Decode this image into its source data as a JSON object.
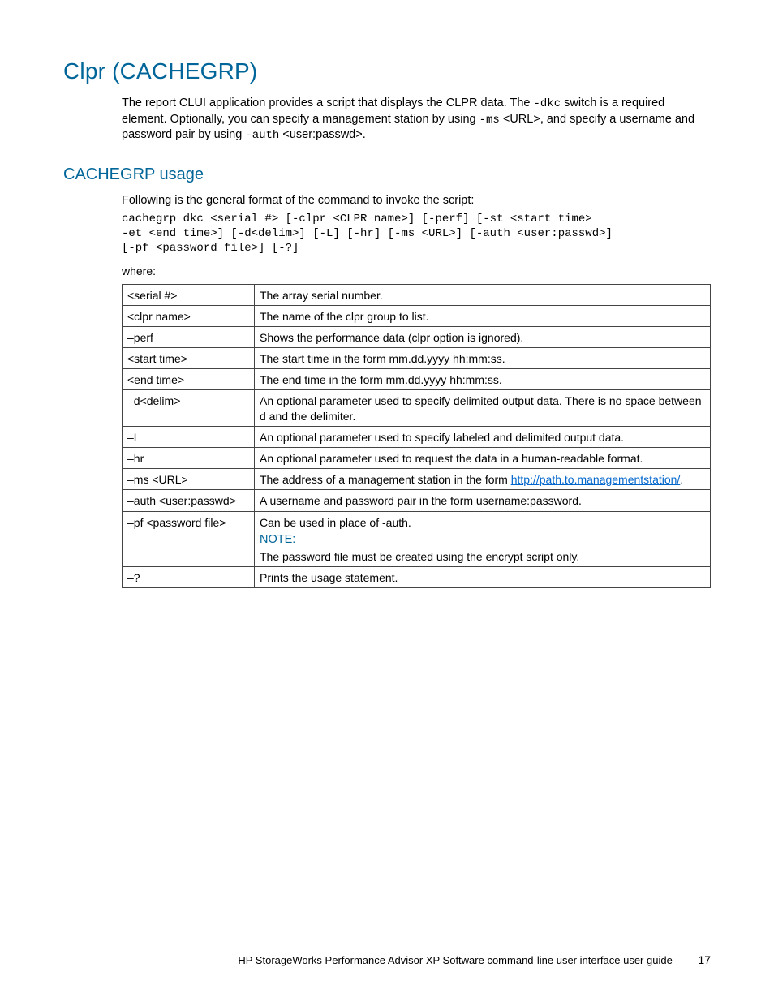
{
  "h1": "Clpr (CACHEGRP)",
  "intro": {
    "pre_dkc": "The report CLUI application provides a script that displays the CLPR data. The ",
    "dkc": "-dkc",
    "post_dkc": " switch is a required element. Optionally, you can specify a management station by using ",
    "ms": "-ms",
    "post_ms": " <URL>, and specify a username and password pair by using ",
    "auth": "-auth",
    "post_auth": " <user:passwd>."
  },
  "h2": "CACHEGRP usage",
  "usage_intro": "Following is the general format of the command to invoke the script:",
  "usage_code": "cachegrp dkc <serial #> [-clpr <CLPR name>] [-perf] [-st <start time>\n-et <end time>] [-d<delim>] [-L] [-hr] [-ms <URL>] [-auth <user:passwd>]\n[-pf <password file>] [-?]",
  "where": "where:",
  "rows": [
    {
      "p": "<serial #>",
      "d": "The array serial number."
    },
    {
      "p": "<clpr name>",
      "d": "The name of the clpr group to list."
    },
    {
      "p": "–perf",
      "d": "Shows the performance data (clpr option is ignored)."
    },
    {
      "p": "<start time>",
      "d": "The start time in the form mm.dd.yyyy hh:mm:ss."
    },
    {
      "p": "<end time>",
      "d": "The end time in the form mm.dd.yyyy hh:mm:ss."
    },
    {
      "p": "–d<delim>",
      "d": "An optional parameter used to specify delimited output data. There is no space between d and the delimiter."
    },
    {
      "p": "–L",
      "d": "An optional parameter used to specify labeled and delimited output data."
    },
    {
      "p": "–hr",
      "d": "An optional parameter used to request the data in a human-readable format."
    }
  ],
  "row_ms": {
    "p": "–ms <URL>",
    "pre": "The address of a management station in the form ",
    "link": "http://path.to.managementstation/",
    "post": "."
  },
  "row_auth": {
    "p": "–auth <user:passwd>",
    "d": "A username and password pair in the form username:password."
  },
  "row_pf": {
    "p": "–pf <password file>",
    "line1": "Can be used in place of -auth.",
    "note_label": "NOTE:",
    "line2": "The password file must be created using the encrypt script only."
  },
  "row_q": {
    "p": "–?",
    "d": "Prints the usage statement."
  },
  "footer_text": "HP StorageWorks Performance Advisor XP Software command-line user interface user guide",
  "page_number": "17"
}
